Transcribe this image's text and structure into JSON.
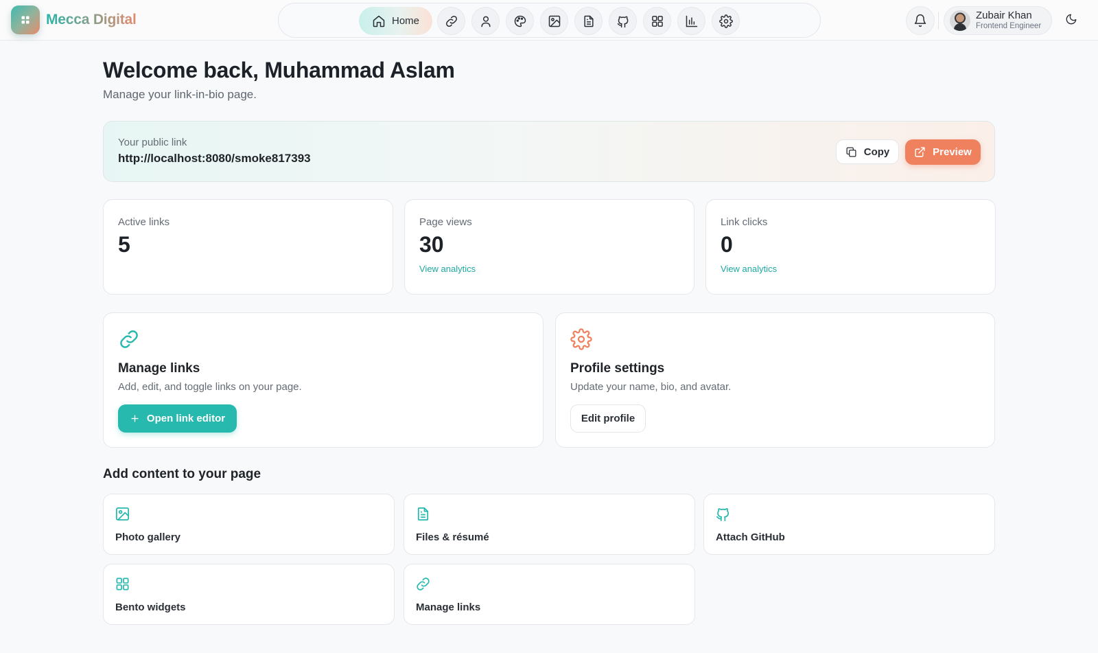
{
  "brand": {
    "name": "Mecca Digital"
  },
  "nav": {
    "home_label": "Home",
    "items": [
      "link-icon",
      "user-icon",
      "palette-icon",
      "image-icon",
      "file-icon",
      "github-icon",
      "grid-icon",
      "chart-icon",
      "gear-icon"
    ]
  },
  "user": {
    "name": "Zubair Khan",
    "role": "Frontend Engineer"
  },
  "header": {
    "welcome": "Welcome back, Muhammad Aslam",
    "subtitle": "Manage your link-in-bio page."
  },
  "public_link": {
    "label": "Your public link",
    "url": "http://localhost:8080/smoke817393",
    "copy_label": "Copy",
    "preview_label": "Preview"
  },
  "stats": [
    {
      "label": "Active links",
      "value": "5",
      "link": ""
    },
    {
      "label": "Page views",
      "value": "30",
      "link": "View analytics"
    },
    {
      "label": "Link clicks",
      "value": "0",
      "link": "View analytics"
    }
  ],
  "actions": {
    "manage": {
      "title": "Manage links",
      "desc": "Add, edit, and toggle links on your page.",
      "button": "Open link editor"
    },
    "profile": {
      "title": "Profile settings",
      "desc": "Update your name, bio, and avatar.",
      "button": "Edit profile"
    }
  },
  "content": {
    "title": "Add content to your page",
    "tiles": [
      {
        "label": "Photo gallery",
        "icon": "image-icon"
      },
      {
        "label": "Files & résumé",
        "icon": "file-icon"
      },
      {
        "label": "Attach GitHub",
        "icon": "github-icon"
      },
      {
        "label": "Bento widgets",
        "icon": "grid-icon"
      },
      {
        "label": "Manage links",
        "icon": "link-icon"
      }
    ]
  },
  "colors": {
    "teal": "#27b8ae",
    "coral": "#f0815f",
    "text": "#1f2328",
    "muted": "#646b74"
  }
}
